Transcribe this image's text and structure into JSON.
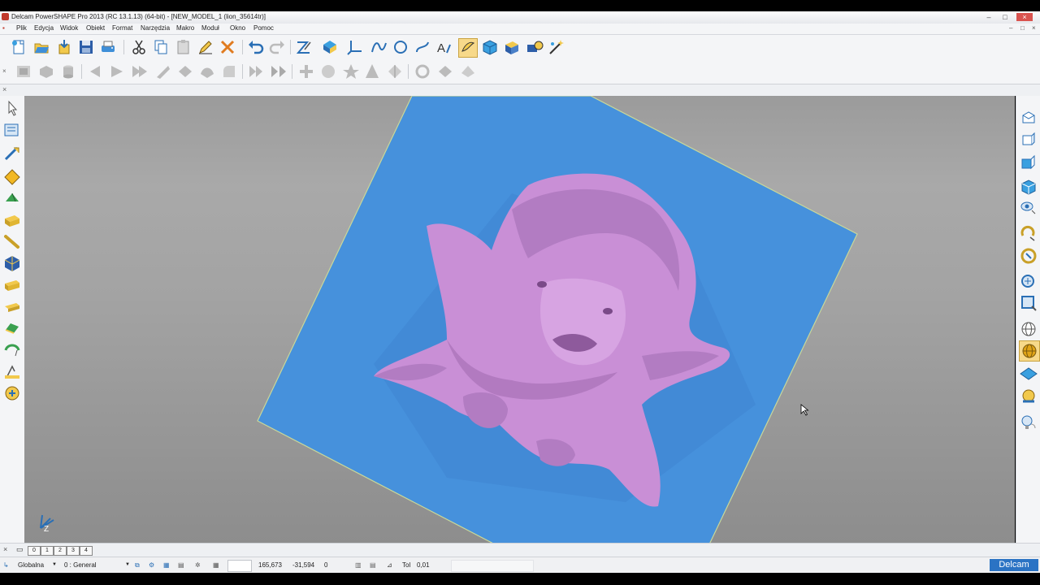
{
  "window": {
    "title": "Delcam PowerSHAPE Pro 2013 (RC 13.1.13) (64-bit) - [NEW_MODEL_1 (lion_35614tr)]",
    "controls": [
      "–",
      "□",
      "×"
    ],
    "mdi_controls": [
      "–",
      "□",
      "×"
    ]
  },
  "menu": {
    "items": [
      "Plik",
      "Edycja",
      "Widok",
      "Obiekt",
      "Format",
      "Narzędzia",
      "Makro",
      "Moduł",
      "Okno",
      "Pomoc"
    ]
  },
  "toolbar_main": {
    "icons": [
      "new-model-icon",
      "open-icon",
      "import-icon",
      "save-icon",
      "print-icon",
      "cut-icon",
      "copy-icon",
      "paste-icon",
      "edit-icon",
      "delete-icon",
      "undo-icon",
      "redo-icon",
      "sketch-icon",
      "workplane-icon",
      "axis-icon",
      "curve-icon",
      "circle-icon",
      "arc-icon",
      "text-icon",
      "select-shape-icon",
      "solid-icon",
      "surface-icon",
      "assembly-icon",
      "wizard-icon"
    ]
  },
  "toolbar_secondary": {
    "icons": [
      "shade-icon",
      "shade-mode-icon",
      "cylinder-icon",
      "view-front-icon",
      "view-right-icon",
      "view-iso-icon",
      "slice-icon",
      "blend-icon",
      "smooth-icon",
      "fillet-icon",
      "mirror-icon",
      "offset-icon",
      "add-icon",
      "sphere-icon",
      "star-icon",
      "cone-icon",
      "scale-icon",
      "cut-solid-icon",
      "shell-icon",
      "fill-icon"
    ]
  },
  "left_toolbar": {
    "icons": [
      "select-icon",
      "multi-select-icon",
      "wireframe-icon",
      "surface-diamond-icon",
      "solid-green-icon",
      "block-icon",
      "line-icon",
      "cube-icon",
      "box-yellow-icon",
      "box-yellow-2-icon",
      "solid-edit-icon",
      "curve-edit-icon",
      "measure-icon",
      "analysis-icon"
    ]
  },
  "right_toolbar": {
    "icons": [
      "view-top-icon",
      "view-front-icon",
      "view-iso-icon",
      "view-cube-icon",
      "view-eye-icon",
      "rotate-icon",
      "spin-icon",
      "zoom-icon",
      "zoom-box-icon",
      "globe-icon",
      "shaded-sphere-icon",
      "plane-icon",
      "light-icon",
      "lightbulb-icon"
    ]
  },
  "viewport": {
    "background": "#9d9d9d",
    "plate_color": "#4691dc",
    "model_color": "#c98fd6",
    "axis_label": "Z"
  },
  "tabs": {
    "items": [
      "0",
      "1",
      "2",
      "3",
      "4"
    ]
  },
  "status": {
    "coord_system": "Globalna",
    "level": "0  : General",
    "x": "165,673",
    "y": "-31,594",
    "z": "0",
    "tol_label": "Tol",
    "tol_value": "0,01",
    "brand": "Delcam"
  }
}
